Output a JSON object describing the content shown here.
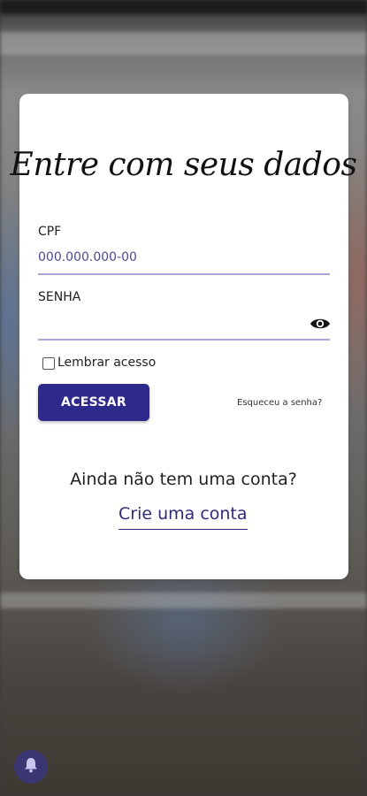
{
  "login": {
    "title": "Entre com seus dados",
    "cpf_label": "CPF",
    "cpf_placeholder": "000.000.000-00",
    "cpf_value": "",
    "password_label": "SENHA",
    "password_value": "",
    "remember_label": "Lembrar acesso",
    "remember_checked": false,
    "submit_label": "ACESSAR",
    "forgot_link": "Esqueceu a senha?",
    "no_account_text": "Ainda não tem uma conta?",
    "create_account_link": "Crie uma conta"
  },
  "icons": {
    "password_toggle": "eye-icon",
    "notification": "bell-icon"
  },
  "colors": {
    "accent": "#2e2a8c",
    "underline": "#a7a6d4",
    "link": "#2f2a7c"
  }
}
